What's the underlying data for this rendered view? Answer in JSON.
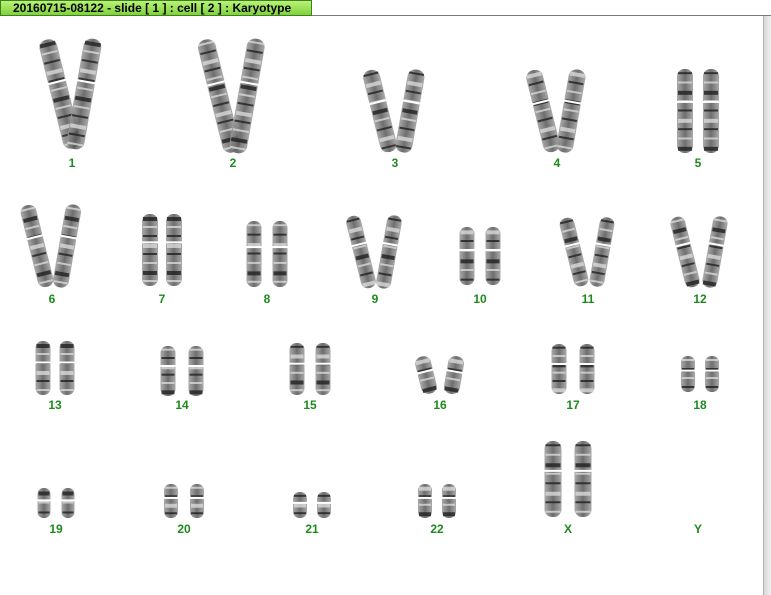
{
  "window": {
    "title": "20160715-08122 - slide [ 1 ] : cell [ 2 ] : Karyotype"
  },
  "colors": {
    "title_bg": "#8cd94a",
    "label": "#1e8a1e",
    "chromosome": "#3a3a3a"
  },
  "karyotype": {
    "labels": [
      "1",
      "2",
      "3",
      "4",
      "5",
      "6",
      "7",
      "8",
      "9",
      "10",
      "11",
      "12",
      "13",
      "14",
      "15",
      "16",
      "17",
      "18",
      "19",
      "20",
      "21",
      "22",
      "X",
      "Y"
    ]
  }
}
